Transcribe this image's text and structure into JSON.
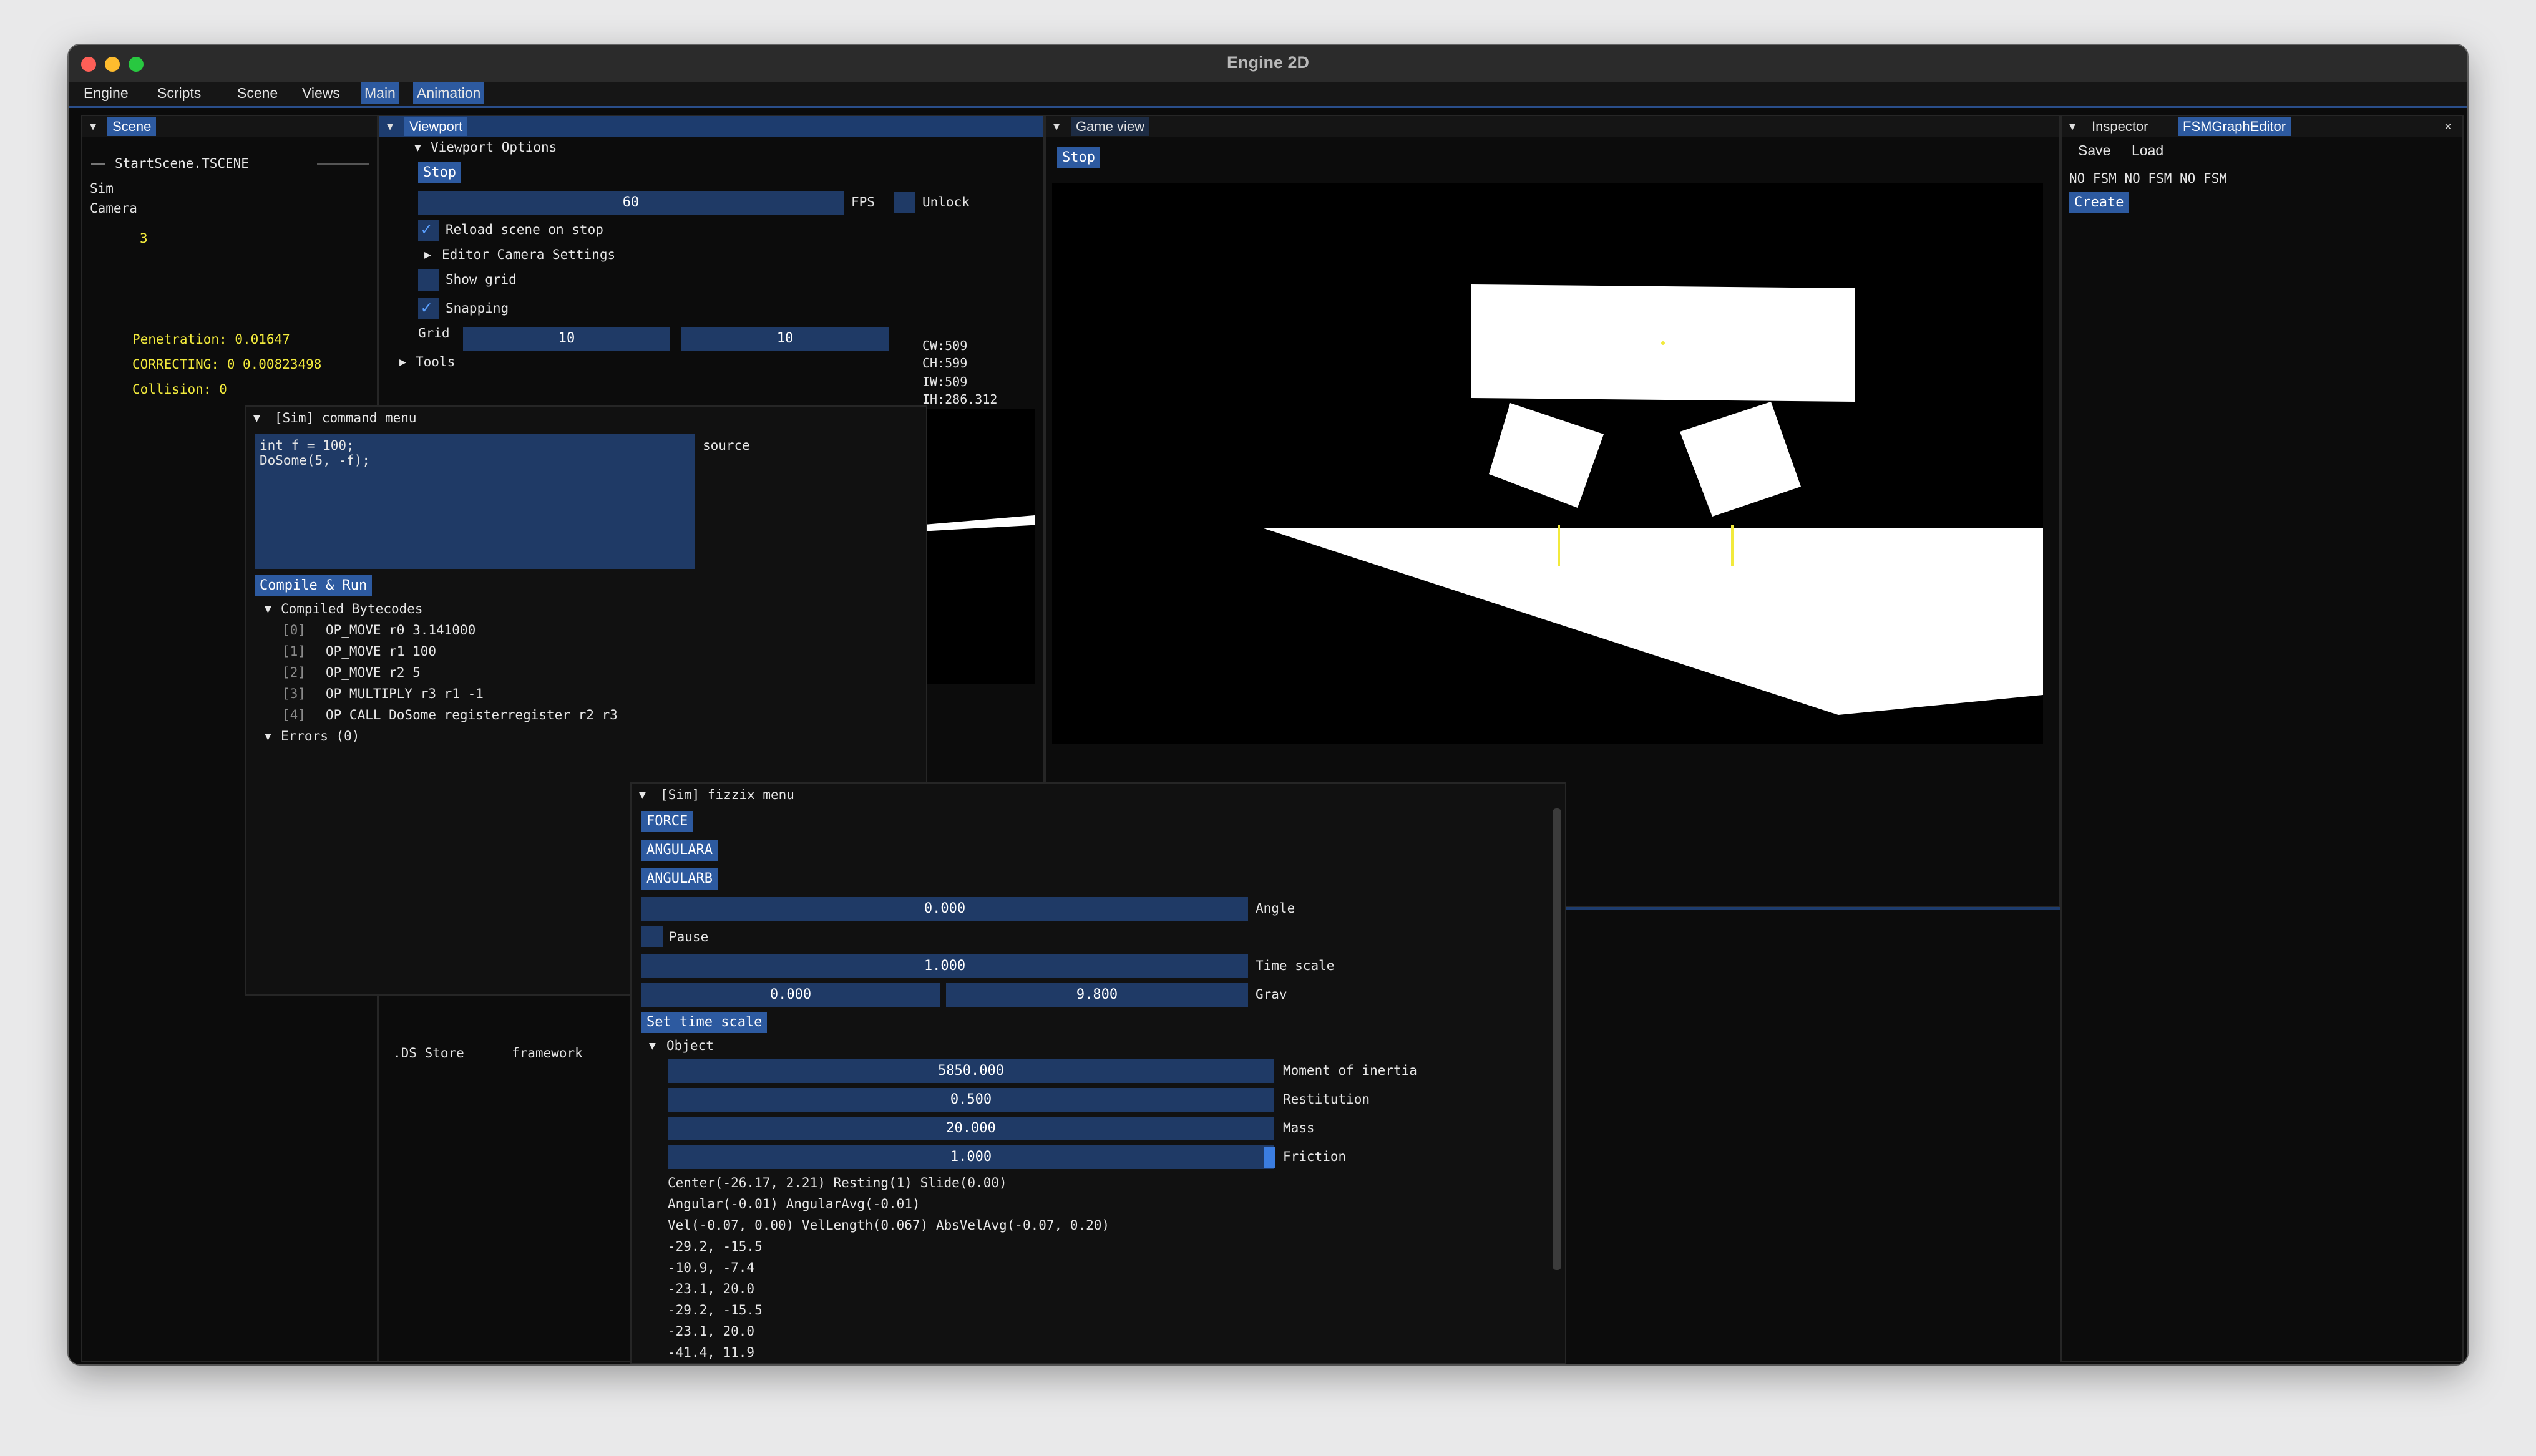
{
  "window": {
    "title": "Engine 2D"
  },
  "menubar": {
    "items": [
      "Engine",
      "Scripts",
      "Scene",
      "Views",
      "Main",
      "Animation"
    ],
    "active": "Main"
  },
  "scene_panel": {
    "tab": "Scene",
    "scene_file": "StartScene.TSCENE",
    "items": [
      "Sim",
      "Camera"
    ],
    "count": "3",
    "debug": [
      "Penetration: 0.01647",
      "CORRECTING: 0 0.00823498",
      "Collision: 0"
    ]
  },
  "viewport_panel": {
    "tab": "Viewport",
    "section": "Viewport Options",
    "stop_label": "Stop",
    "fps_value": "60",
    "fps_label": "FPS",
    "unlock_label": "Unlock",
    "reload_label": "Reload scene on stop",
    "reload_checked": true,
    "camera_settings_label": "Editor Camera Settings",
    "show_grid_label": "Show grid",
    "show_grid_checked": false,
    "snapping_label": "Snapping",
    "snapping_checked": true,
    "grid_label": "Grid",
    "grid_x": "10",
    "grid_y": "10",
    "tools_label": "Tools",
    "info": [
      "CW:509",
      "CH:599",
      "IW:509",
      "IH:286.312"
    ]
  },
  "command_menu": {
    "title": "[Sim] command menu",
    "code": [
      "int f = 100;",
      "DoSome(5, -f);"
    ],
    "source_label": "source",
    "compile_label": "Compile & Run",
    "bytecodes_label": "Compiled Bytecodes",
    "bytecodes": [
      {
        "idx": "[0]",
        "op": "OP_MOVE r0 3.141000"
      },
      {
        "idx": "[1]",
        "op": "OP_MOVE r1 100"
      },
      {
        "idx": "[2]",
        "op": "OP_MOVE r2 5"
      },
      {
        "idx": "[3]",
        "op": "OP_MULTIPLY r3 r1 -1"
      },
      {
        "idx": "[4]",
        "op": "OP_CALL DoSome registerregister r2 r3"
      }
    ],
    "errors_label": "Errors (0)"
  },
  "game_view": {
    "tab": "Game view",
    "stop_label": "Stop"
  },
  "inspector": {
    "tabs": [
      "Inspector",
      "FSMGraphEditor"
    ],
    "active_tab": "FSMGraphEditor",
    "save_label": "Save",
    "load_label": "Load",
    "fsm_status": "NO FSM NO FSM NO FSM",
    "create_label": "Create"
  },
  "assets": {
    "files": [
      ".DS_Store",
      "framework"
    ]
  },
  "fizzix_menu": {
    "title": "[Sim] fizzix menu",
    "buttons": [
      "FORCE",
      "ANGULARA",
      "ANGULARB"
    ],
    "angle": {
      "value": "0.000",
      "label": "Angle"
    },
    "pause_label": "Pause",
    "time_scale": {
      "value": "1.000",
      "label": "Time scale"
    },
    "grav": {
      "x": "0.000",
      "y": "9.800",
      "label": "Grav"
    },
    "set_time_scale_label": "Set time scale",
    "object_label": "Object",
    "object_fields": [
      {
        "value": "5850.000",
        "label": "Moment of inertia"
      },
      {
        "value": "0.500",
        "label": "Restitution"
      },
      {
        "value": "20.000",
        "label": "Mass"
      },
      {
        "value": "1.000",
        "label": "Friction"
      }
    ],
    "object_info": [
      "Center(-26.17, 2.21) Resting(1) Slide(0.00)",
      "Angular(-0.01) AngularAvg(-0.01)",
      "Vel(-0.07, 0.00) VelLength(0.067) AbsVelAvg(-0.07, 0.20)",
      "-29.2, -15.5",
      "-10.9, -7.4",
      "-23.1, 20.0",
      "-29.2, -15.5",
      "-23.1, 20.0",
      "-41.4, 11.9"
    ]
  },
  "colors": {
    "accent": "#2d5aa0",
    "field": "#1f3a66",
    "debug_text": "#f2ea3c"
  }
}
